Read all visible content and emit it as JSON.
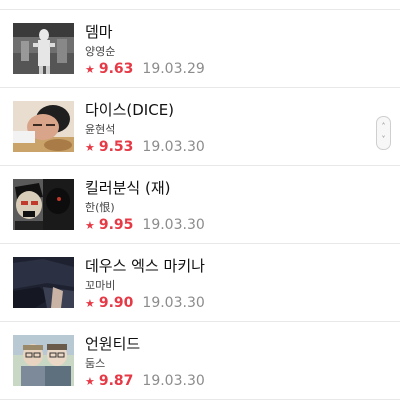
{
  "list": {
    "items": [
      {
        "title": "뎀마",
        "author": "양영순",
        "rating": "9.63",
        "date": "19.03.29",
        "thumb": "demma-thumbnail"
      },
      {
        "title": "다이스(DICE)",
        "author": "윤현석",
        "rating": "9.53",
        "date": "19.03.30",
        "thumb": "dice-thumbnail"
      },
      {
        "title": "킬러분식 (재)",
        "author": "한(恨)",
        "rating": "9.95",
        "date": "19.03.30",
        "thumb": "killer-bunsik-thumbnail"
      },
      {
        "title": "데우스 엑스 마키나",
        "author": "꼬마비",
        "rating": "9.90",
        "date": "19.03.30",
        "thumb": "deus-ex-machina-thumbnail"
      },
      {
        "title": "언원티드",
        "author": "둠스",
        "rating": "9.87",
        "date": "19.03.30",
        "thumb": "unwanted-thumbnail"
      }
    ],
    "star_icon": "star-icon",
    "star_glyph": "★"
  },
  "scrollbar": {
    "icon": "scroll-handle-icon",
    "up_glyph": "˄",
    "down_glyph": "˅"
  },
  "colors": {
    "rating": "#e63946",
    "date": "#8c8c8c",
    "divider": "#e8e8e8"
  }
}
